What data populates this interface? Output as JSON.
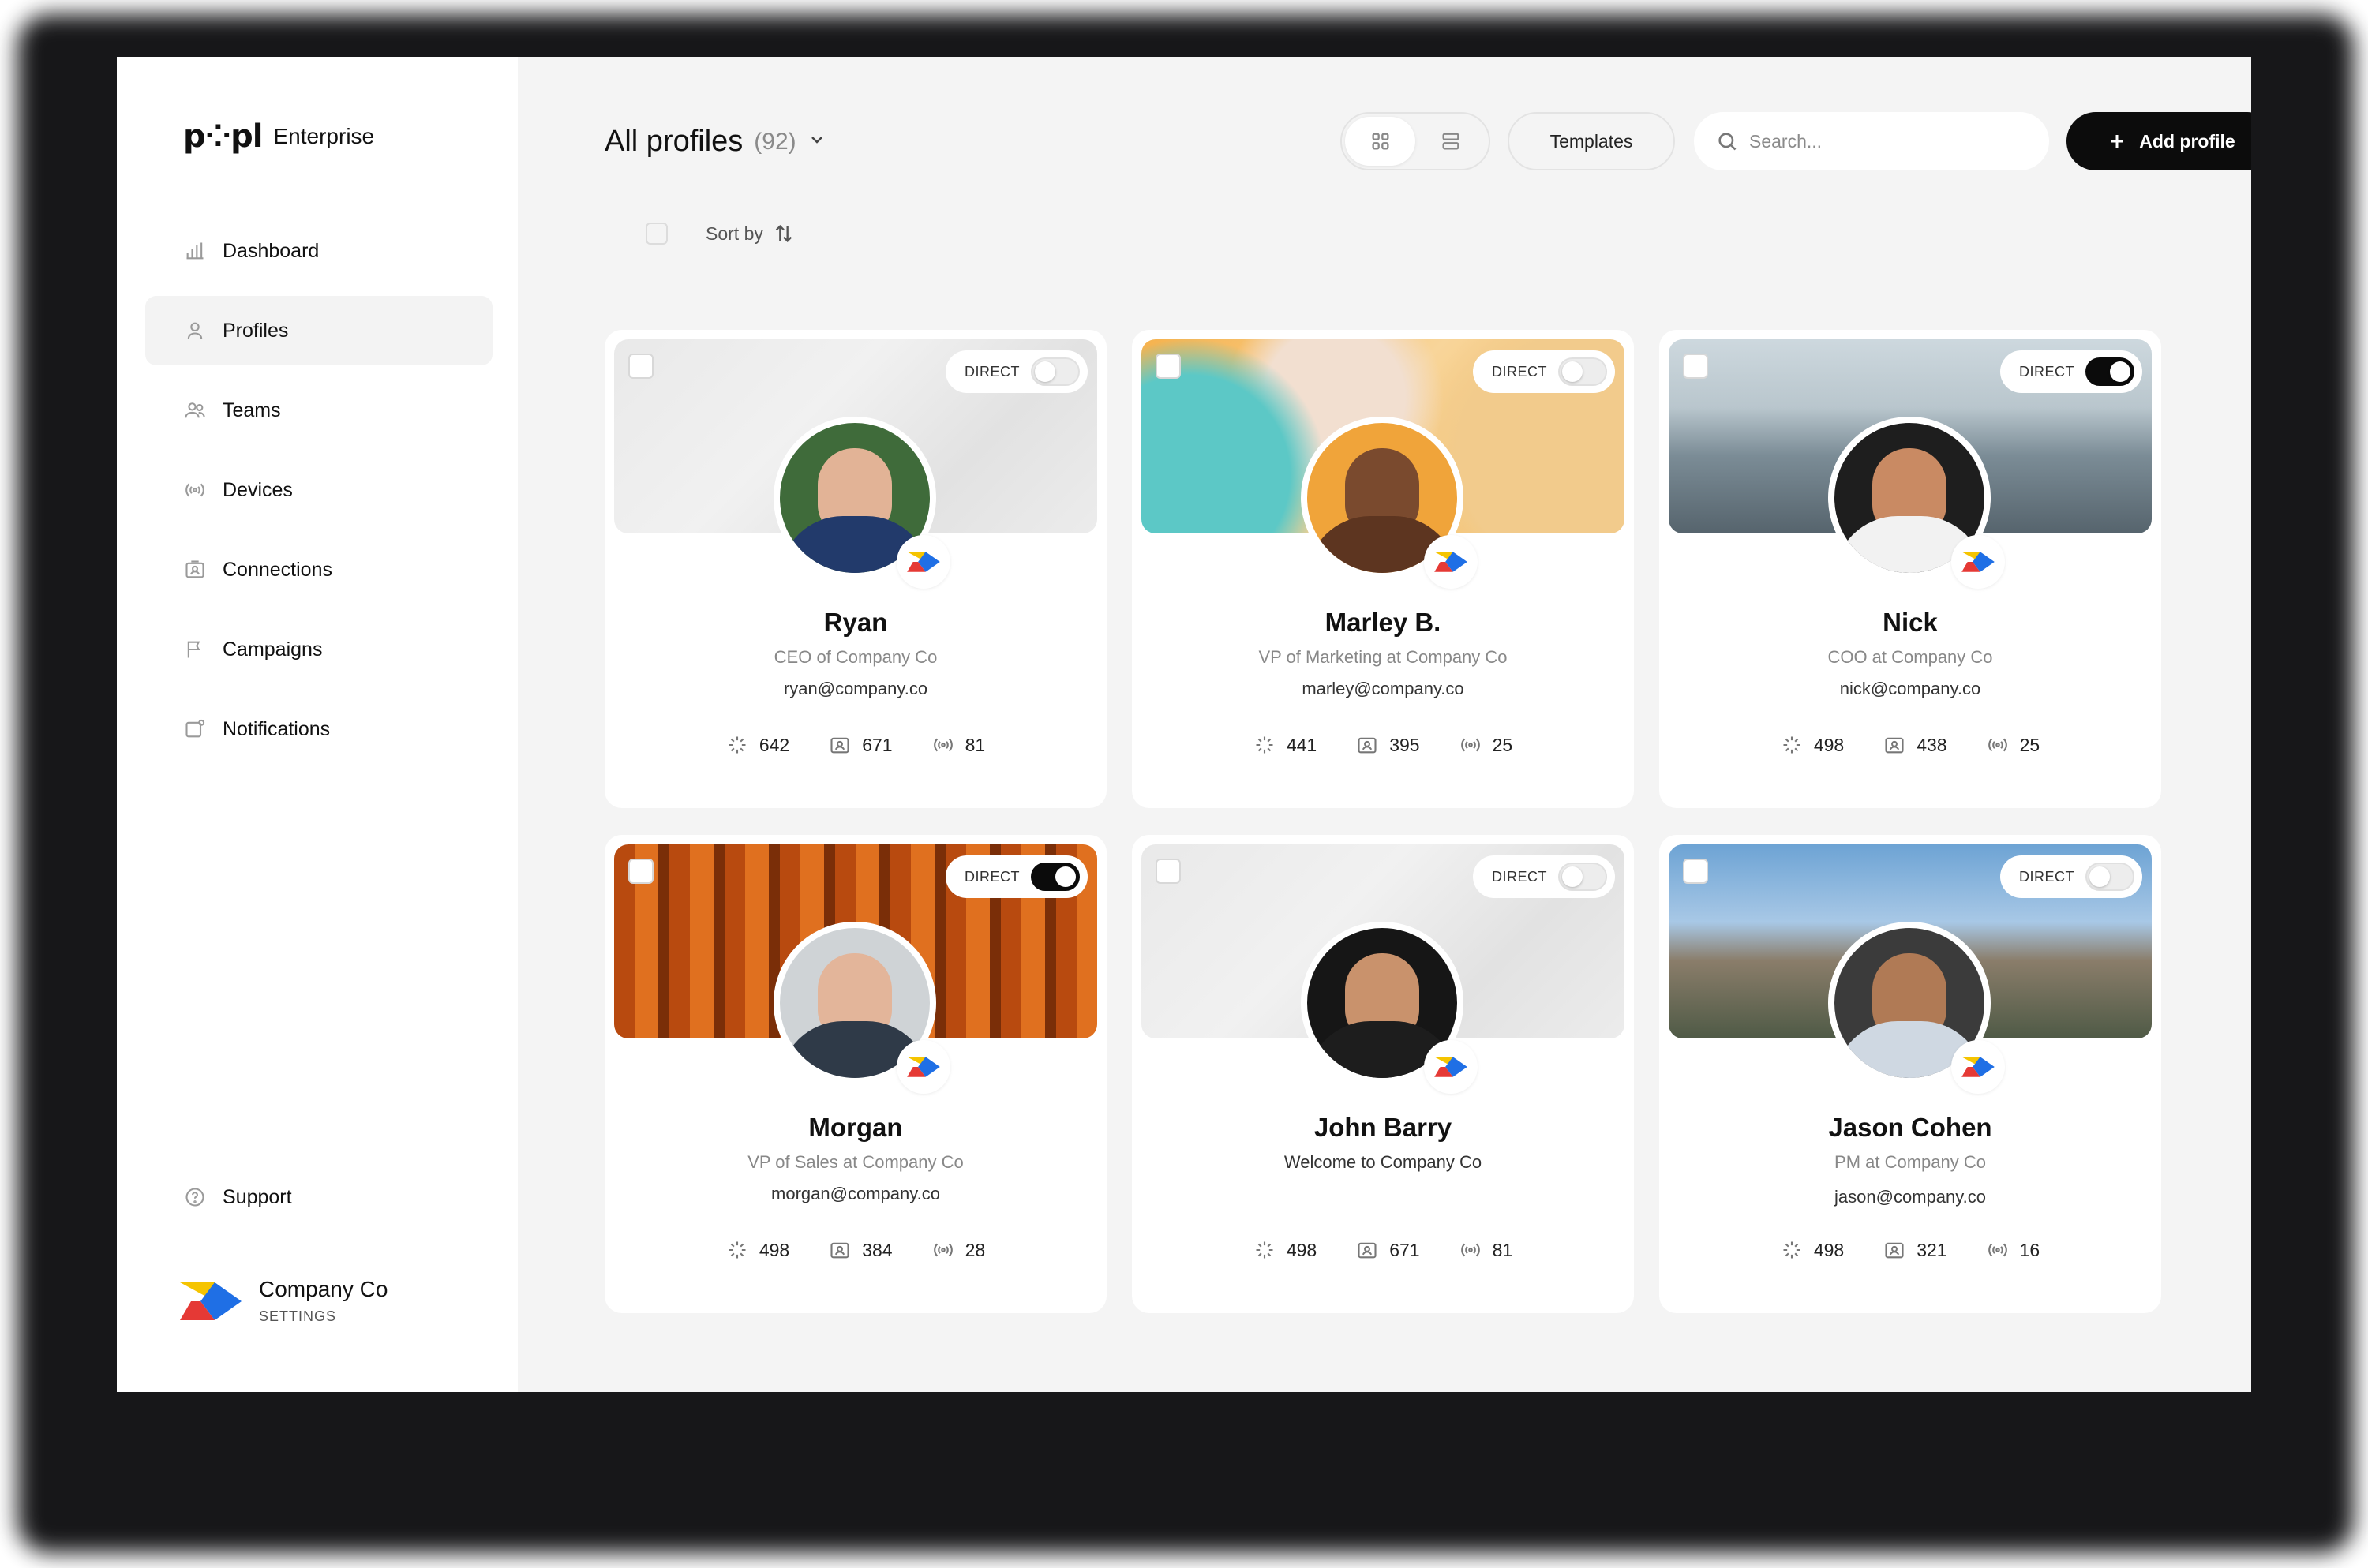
{
  "brand": {
    "logo": "p⁘pl",
    "name": "Enterprise"
  },
  "sidebar": {
    "items": [
      {
        "label": "Dashboard",
        "icon": "bar-chart-icon"
      },
      {
        "label": "Profiles",
        "icon": "user-icon",
        "active": true
      },
      {
        "label": "Teams",
        "icon": "users-icon"
      },
      {
        "label": "Devices",
        "icon": "nfc-icon"
      },
      {
        "label": "Connections",
        "icon": "contact-card-icon"
      },
      {
        "label": "Campaigns",
        "icon": "flag-icon"
      },
      {
        "label": "Notifications",
        "icon": "bell-icon"
      }
    ],
    "support": "Support",
    "company": {
      "name": "Company Co",
      "settings": "SETTINGS"
    }
  },
  "header": {
    "title": "All profiles",
    "count": "(92)",
    "templates": "Templates",
    "search_placeholder": "Search...",
    "add_profile": "Add profile"
  },
  "sort": {
    "label": "Sort by"
  },
  "toggle_label": "DIRECT",
  "colors": {
    "accent": "#0c0c0c",
    "badge_blue": "#1f6fe5",
    "badge_red": "#e53935",
    "badge_yellow": "#f5c400"
  },
  "profiles": [
    {
      "name": "Ryan",
      "role": "CEO of Company Co",
      "email": "ryan@company.co",
      "views": "642",
      "connections": "671",
      "taps": "81",
      "direct": false
    },
    {
      "name": "Marley B.",
      "role": "VP of Marketing at Company Co",
      "email": "marley@company.co",
      "views": "441",
      "connections": "395",
      "taps": "25",
      "direct": false
    },
    {
      "name": "Nick",
      "role": "COO at Company Co",
      "email": "nick@company.co",
      "views": "498",
      "connections": "438",
      "taps": "25",
      "direct": true
    },
    {
      "name": "Morgan",
      "role": "VP of Sales at Company Co",
      "email": "morgan@company.co",
      "views": "498",
      "connections": "384",
      "taps": "28",
      "direct": true
    },
    {
      "name": "John Barry",
      "role": "",
      "email": "Welcome to Company Co",
      "views": "498",
      "connections": "671",
      "taps": "81",
      "direct": false
    },
    {
      "name": "Jason Cohen",
      "role": "PM at Company Co",
      "email": "jason@company.co",
      "views": "498",
      "connections": "321",
      "taps": "16",
      "direct": false
    }
  ]
}
